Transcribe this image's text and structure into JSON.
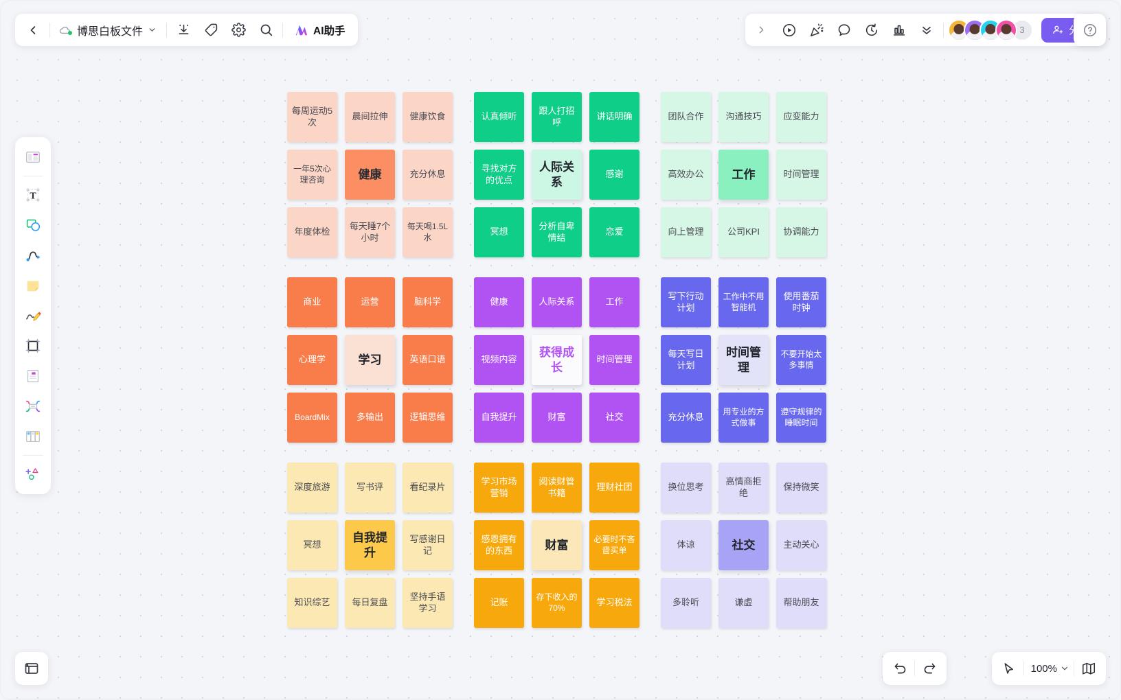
{
  "app": {
    "doc_title": "博思白板文件",
    "ai_label": "AI助手",
    "share_label": "分享",
    "collaborator_count": "3",
    "zoom_level": "100%"
  },
  "toolbar_left": {
    "items": [
      {
        "name": "back-button",
        "icon": "chevron-left-icon"
      },
      {
        "name": "document-title-chip",
        "icon": "cloud-sync-icon"
      },
      {
        "name": "export-button",
        "icon": "download-icon"
      },
      {
        "name": "tag-button",
        "icon": "tag-icon"
      },
      {
        "name": "settings-button",
        "icon": "gear-icon"
      },
      {
        "name": "search-button",
        "icon": "search-icon"
      },
      {
        "name": "ai-assistant-button",
        "icon": "ai-sparkle-icon"
      }
    ]
  },
  "toolbar_right": {
    "items": [
      {
        "name": "expand-button",
        "icon": "chevron-right-icon"
      },
      {
        "name": "present-button",
        "icon": "play-circle-icon"
      },
      {
        "name": "celebrate-button",
        "icon": "party-popper-icon"
      },
      {
        "name": "comment-button",
        "icon": "comment-bubble-icon"
      },
      {
        "name": "timer-button",
        "icon": "timer-icon"
      },
      {
        "name": "vote-button",
        "icon": "bar-chart-icon"
      },
      {
        "name": "more-button",
        "icon": "chevron-double-down-icon"
      }
    ]
  },
  "rail": {
    "items": [
      {
        "name": "template-tool",
        "icon": "template-icon"
      },
      {
        "name": "text-tool",
        "icon": "text-t-icon"
      },
      {
        "name": "shape-tool",
        "icon": "shape-icon"
      },
      {
        "name": "connector-tool",
        "icon": "curve-line-icon"
      },
      {
        "name": "sticky-note-tool",
        "icon": "sticky-note-icon"
      },
      {
        "name": "pen-tool",
        "icon": "pencil-scribble-icon"
      },
      {
        "name": "frame-tool",
        "icon": "frame-crop-icon"
      },
      {
        "name": "card-tool",
        "icon": "note-card-icon"
      },
      {
        "name": "mindmap-tool",
        "icon": "mindmap-icon"
      },
      {
        "name": "kanban-tool",
        "icon": "kanban-columns-icon"
      },
      {
        "name": "more-tools",
        "icon": "plus-shapes-icon"
      }
    ]
  },
  "bottom_controls": {
    "undo": {
      "name": "undo-button",
      "icon": "undo-arrow-icon"
    },
    "redo": {
      "name": "redo-button",
      "icon": "redo-arrow-icon"
    },
    "cursor": {
      "name": "cursor-tool-button",
      "icon": "cursor-arrow-icon"
    },
    "zoom": {
      "name": "zoom-level-selector",
      "icon": "chevron-down-icon"
    },
    "fit": {
      "name": "fit-to-screen-button",
      "icon": "map-fold-icon"
    },
    "minimap": {
      "name": "minimap-button",
      "icon": "minimap-icon"
    }
  },
  "colors": {
    "accent_purple": "#7b5cf0",
    "health_note": "#fbd5c6",
    "health_center": "#fb8f63",
    "relations_note": "#0fce87",
    "relations_center": "#ccf7e5",
    "work_note": "#d7f7e6",
    "work_center": "#8af0c0",
    "study_note": "#f97d4b",
    "study_center": "#fbe0d4",
    "growth_note": "#b153f2",
    "growth_center": "#fbfafc",
    "time_note": "#6868ef",
    "time_center": "#e2e2f8",
    "self_note": "#fce8b2",
    "self_center": "#fcc94a",
    "wealth_note": "#f7a80c",
    "wealth_center": "#fce7b9",
    "social_note": "#e0ddfa",
    "social_center": "#a8a4f5"
  },
  "clusters": [
    {
      "id": "health",
      "title": "健康",
      "note_color": "#fbd5c6",
      "note_text_color": "#4a4a52",
      "center_color": "#fb8f63",
      "center_text_color": "#2b2b33",
      "notes": [
        "每周运动5次",
        "晨间拉伸",
        "健康饮食",
        "一年5次心理咨询",
        "健康",
        "充分休息",
        "年度体检",
        "每天睡7个小时",
        "每天喝1.5L水"
      ]
    },
    {
      "id": "relations",
      "title": "人际关系",
      "note_color": "#0fce87",
      "note_text_color": "#ffffff",
      "center_color": "#ccf7e5",
      "center_text_color": "#22242c",
      "notes": [
        "认真倾听",
        "跟人打招呼",
        "讲话明确",
        "寻找对方的优点",
        "人际关系",
        "感谢",
        "冥想",
        "分析自卑情结",
        "恋爱"
      ]
    },
    {
      "id": "work",
      "title": "工作",
      "note_color": "#d7f7e6",
      "note_text_color": "#4a4a52",
      "center_color": "#8af0c0",
      "center_text_color": "#22242c",
      "notes": [
        "团队合作",
        "沟通技巧",
        "应变能力",
        "高效办公",
        "工作",
        "时间管理",
        "向上管理",
        "公司KPI",
        "协调能力"
      ]
    },
    {
      "id": "study",
      "title": "学习",
      "note_color": "#f97d4b",
      "note_text_color": "#ffffff",
      "center_color": "#fbe0d4",
      "center_text_color": "#22242c",
      "notes": [
        "商业",
        "运营",
        "脑科学",
        "心理学",
        "学习",
        "英语口语",
        "BoardMix",
        "多输出",
        "逻辑思维"
      ]
    },
    {
      "id": "growth",
      "title": "获得成长",
      "note_color": "#b153f2",
      "note_text_color": "#ffffff",
      "center_color": "#fbfafc",
      "center_text_color": "#b153f2",
      "notes": [
        "健康",
        "人际关系",
        "工作",
        "视频内容",
        "获得成长",
        "时间管理",
        "自我提升",
        "财富",
        "社交"
      ]
    },
    {
      "id": "time",
      "title": "时间管理",
      "note_color": "#6868ef",
      "note_text_color": "#ffffff",
      "center_color": "#e2e2f8",
      "center_text_color": "#22242c",
      "notes": [
        "写下行动计划",
        "工作中不用智能机",
        "使用番茄时钟",
        "每天写日计划",
        "时间管理",
        "不要开始太多事情",
        "充分休息",
        "用专业的方式做事",
        "遵守规律的睡眠时间"
      ]
    },
    {
      "id": "self",
      "title": "自我提升",
      "note_color": "#fce8b2",
      "note_text_color": "#4a4a52",
      "center_color": "#fcc94a",
      "center_text_color": "#22242c",
      "notes": [
        "深度旅游",
        "写书评",
        "看纪录片",
        "冥想",
        "自我提升",
        "写感谢日记",
        "知识综艺",
        "每日复盘",
        "坚持手语学习"
      ]
    },
    {
      "id": "wealth",
      "title": "财富",
      "note_color": "#f7a80c",
      "note_text_color": "#ffffff",
      "center_color": "#fce7b9",
      "center_text_color": "#22242c",
      "notes": [
        "学习市场营销",
        "阅读财管书籍",
        "理财社团",
        "感恩拥有的东西",
        "财富",
        "必要时不吝啬买单",
        "记账",
        "存下收入的70%",
        "学习税法"
      ]
    },
    {
      "id": "social",
      "title": "社交",
      "note_color": "#e0ddfa",
      "note_text_color": "#4a4a52",
      "center_color": "#a8a4f5",
      "center_text_color": "#22242c",
      "notes": [
        "换位思考",
        "高情商拒绝",
        "保持微笑",
        "体谅",
        "社交",
        "主动关心",
        "多聆听",
        "谦虚",
        "帮助朋友"
      ]
    }
  ],
  "avatar_colors": [
    "#f2b63c",
    "#9d6ef0",
    "#24d3ef",
    "#f24fa8"
  ]
}
